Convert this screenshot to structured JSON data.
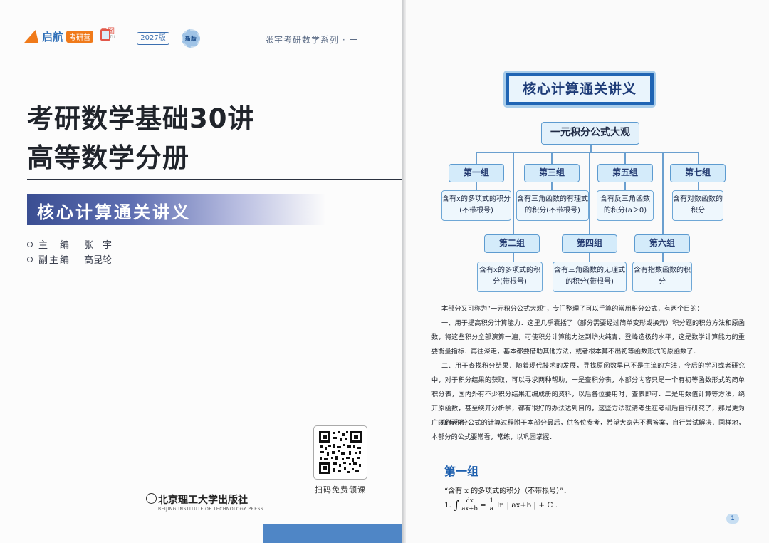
{
  "cover": {
    "logo_qihang": "启航",
    "logo_qihang_sub": "考研营",
    "logo_yuntu": "云图",
    "logo_yuntu_sub": "YUNTU",
    "year_badge": "2027版",
    "new_badge": "新版",
    "series": "张宇考研数学系列 · 一",
    "title_line1": "考研数学基础30讲",
    "title_line2": "高等数学分册",
    "subtitle": "核心计算通关讲义",
    "editors": [
      {
        "role": "主　编",
        "name": "张　宇"
      },
      {
        "role": "副主编",
        "name": "高昆轮"
      }
    ],
    "qr_caption": "扫码免费领课",
    "publisher_cn": "北京理工大学出版社",
    "publisher_en": "BEIJING INSTITUTE OF TECHNOLOGY PRESS"
  },
  "inner": {
    "main_title": "核心计算通关讲义",
    "root": "一元积分公式大观",
    "groups": [
      {
        "label": "第一组",
        "desc": "含有x的多项式的积分(不带根号)"
      },
      {
        "label": "第三组",
        "desc": "含有三角函数的有理式的积分(不带根号)"
      },
      {
        "label": "第五组",
        "desc": "含有反三角函数的积分(a＞0)"
      },
      {
        "label": "第七组",
        "desc": "含有对数函数的积分"
      },
      {
        "label": "第二组",
        "desc": "含有x的多项式的积分(带根号)"
      },
      {
        "label": "第四组",
        "desc": "含有三角函数的无理式的积分(带根号)"
      },
      {
        "label": "第六组",
        "desc": "含有指数函数的积分"
      }
    ],
    "paragraphs": [
      "本部分又可称为“一元积分公式大观”，专门整理了可以手算的常用积分公式，有两个目的：",
      "一、用于提高积分计算能力．这里几乎囊括了（部分需要经过简单变形或换元）积分题的积分方法和原函数，将这些积分全部演算一遍，可使积分计算能力达到炉火纯青、登峰造极的水平，这是数学计算能力的重要衡量指标．再往深走，基本都要借助其他方法，或者根本算不出初等函数形式的原函数了．",
      "二、用于查找积分结果．随着现代技术的发展，寻找原函数早已不是主流的方法，今后的学习或者研究中，对于积分结果的获取，可以寻求两种帮助，一是查积分表，本部分内容只是一个有初等函数形式的简单积分表，国内外有不少积分结果汇编成册的资料，以后各位要用时，查表即可．二是用数值计算等方法，绕开原函数，甚至绕开分析学，都有很好的办法达到目的，这些方法就请考生在考研后自行研究了，那是更为广阔的天地．",
      "所有积分公式的计算过程附于本部分最后，供各位参考，希望大家先不看答案，自行尝试解决．同样地，本部分的公式要常看，常练，以巩固掌握．"
    ],
    "section_title": "第一组",
    "section_sub": "“含有 x 的多项式的积分（不带根号）”．",
    "formula_index": "1.",
    "formula_num": "dx",
    "formula_den": "ax+b",
    "formula_eq": "=",
    "formula_coef_num": "1",
    "formula_coef_den": "a",
    "formula_tail": "ln | ax+b | + C .",
    "page_number": "1"
  }
}
